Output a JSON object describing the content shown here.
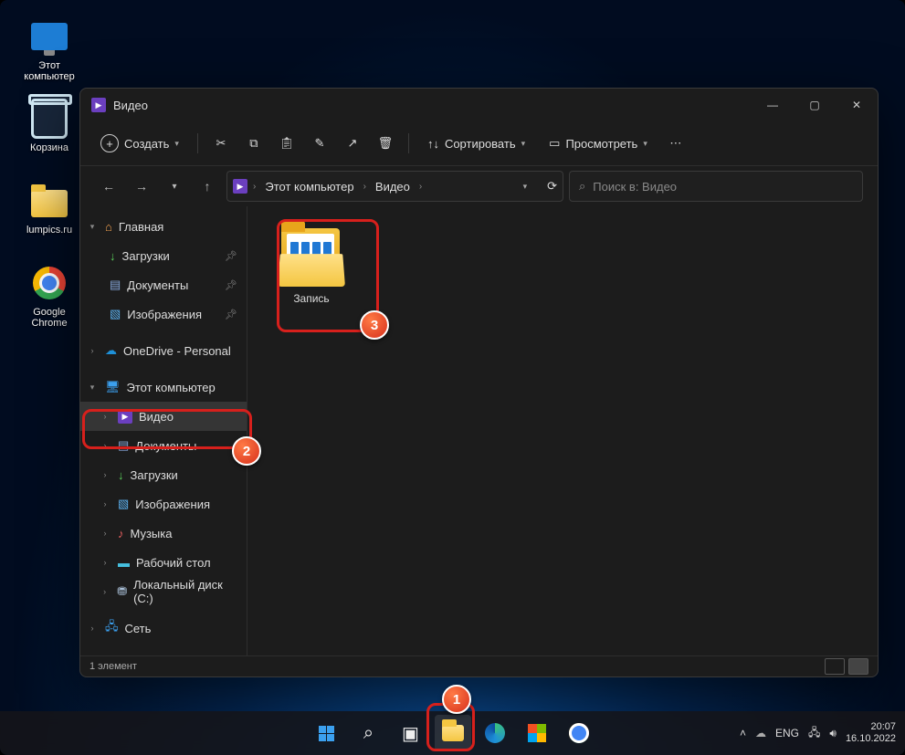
{
  "desktop_icons": [
    {
      "label": "Этот компьютер"
    },
    {
      "label": "Корзина"
    },
    {
      "label": "lumpics.ru"
    },
    {
      "label": "Google Chrome"
    }
  ],
  "window": {
    "title": "Видео",
    "toolbar": {
      "create": "Создать",
      "sort": "Сортировать",
      "view": "Просмотреть"
    },
    "breadcrumb": [
      "Этот компьютер",
      "Видео"
    ],
    "search_placeholder": "Поиск в: Видео",
    "sidebar": {
      "home": "Главная",
      "quick": [
        {
          "label": "Загрузки"
        },
        {
          "label": "Документы"
        },
        {
          "label": "Изображения"
        }
      ],
      "onedrive": "OneDrive - Personal",
      "thispc": "Этот компьютер",
      "pc_items": [
        {
          "label": "Видео"
        },
        {
          "label": "Документы"
        },
        {
          "label": "Загрузки"
        },
        {
          "label": "Изображения"
        },
        {
          "label": "Музыка"
        },
        {
          "label": "Рабочий стол"
        },
        {
          "label": "Локальный диск (C:)"
        }
      ],
      "network": "Сеть"
    },
    "content": {
      "folder": "Запись"
    },
    "status": "1 элемент"
  },
  "tray": {
    "lang": "ENG",
    "time": "20:07",
    "date": "16.10.2022"
  }
}
